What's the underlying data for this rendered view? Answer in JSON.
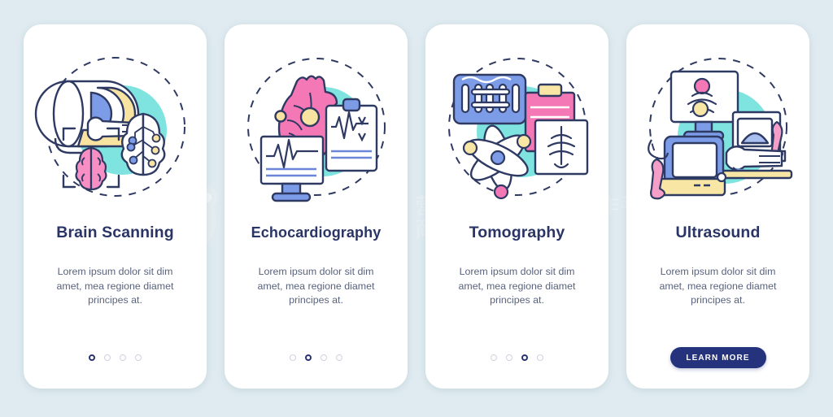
{
  "background_color": "#dfebf0",
  "theme": {
    "card_bg": "#ffffff",
    "title_color": "#2a3566",
    "body_color": "#59637d",
    "accent_navy": "#25327c",
    "accent_teal": "#7fe3df",
    "accent_pink": "#f587c0",
    "accent_blue": "#7d9ce8",
    "accent_yellow": "#f7e6a4",
    "dot_inactive": "#cdd2dd"
  },
  "watermark": {
    "logo_name": "qiantu-logo-icon",
    "brand": "千图",
    "line1": "营销创意服务与协作平台",
    "line2": "商用请获取授权"
  },
  "body_text_default": "Lorem ipsum dolor sit dim amet, mea regione diamet principes at.",
  "cards": [
    {
      "illustration_name": "brain-scanning-illustration",
      "title": "Brain Scanning",
      "body": "Lorem ipsum dolor sit dim amet, mea regione diamet principes at.",
      "footer_type": "dots",
      "dots_total": 4,
      "dots_active_index": 0
    },
    {
      "illustration_name": "echocardiography-illustration",
      "title": "Echocardiography",
      "body": "Lorem ipsum dolor sit dim amet, mea regione diamet principes at.",
      "footer_type": "dots",
      "dots_total": 4,
      "dots_active_index": 1
    },
    {
      "illustration_name": "tomography-illustration",
      "title": "Tomography",
      "body": "Lorem ipsum dolor sit dim amet, mea regione diamet principes at.",
      "footer_type": "dots",
      "dots_total": 4,
      "dots_active_index": 2
    },
    {
      "illustration_name": "ultrasound-illustration",
      "title": "Ultrasound",
      "body": "Lorem ipsum dolor sit dim amet, mea regione diamet principes at.",
      "footer_type": "button",
      "button_label": "LEARN MORE"
    }
  ]
}
